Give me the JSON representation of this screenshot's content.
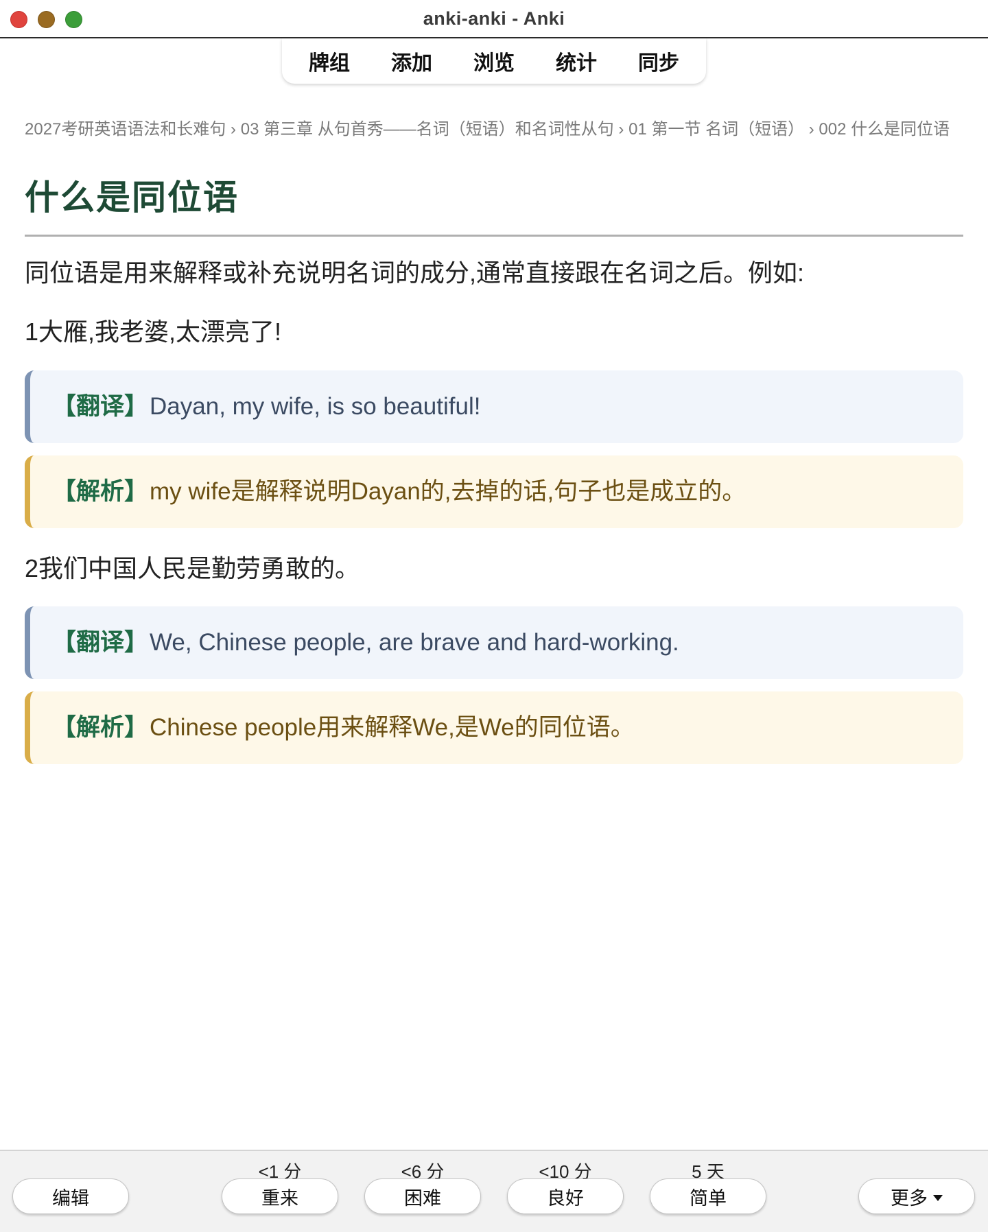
{
  "window": {
    "title": "anki-anki - Anki"
  },
  "topnav": {
    "items": [
      "牌组",
      "添加",
      "浏览",
      "统计",
      "同步"
    ]
  },
  "card": {
    "breadcrumb": "2027考研英语语法和长难句 › 03 第三章 从句首秀——名词（短语）和名词性从句 › 01 第一节 名词（短语） › 002 什么是同位语",
    "title": "什么是同位语",
    "intro": "同位语是用来解释或补充说明名词的成分,通常直接跟在名词之后。例如:",
    "examples": [
      {
        "text": "1大雁,我老婆,太漂亮了!",
        "translation_tag": "【翻译】",
        "translation": "Dayan, my wife, is so beautiful!",
        "analysis_tag": "【解析】",
        "analysis": "my wife是解释说明Dayan的,去掉的话,句子也是成立的。"
      },
      {
        "text": "2我们中国人民是勤劳勇敢的。",
        "translation_tag": "【翻译】",
        "translation": "We, Chinese people, are brave and hard-working.",
        "analysis_tag": "【解析】",
        "analysis": "Chinese people用来解释We,是We的同位语。"
      }
    ]
  },
  "bottombar": {
    "edit_label": "编辑",
    "answers": [
      {
        "interval": "<1 分",
        "label": "重来"
      },
      {
        "interval": "<6 分",
        "label": "困难"
      },
      {
        "interval": "<10 分",
        "label": "良好"
      },
      {
        "interval": "5 天",
        "label": "简单"
      }
    ],
    "more_label": "更多"
  },
  "colors": {
    "title_green": "#1e4a35",
    "tag_green": "#1f6b46",
    "translation_bg": "#f1f5fb",
    "translation_border": "#7d93b3",
    "analysis_bg": "#fef8e8",
    "analysis_border": "#d9ad48"
  },
  "icons": {
    "more_caret": "caret-down-icon"
  }
}
